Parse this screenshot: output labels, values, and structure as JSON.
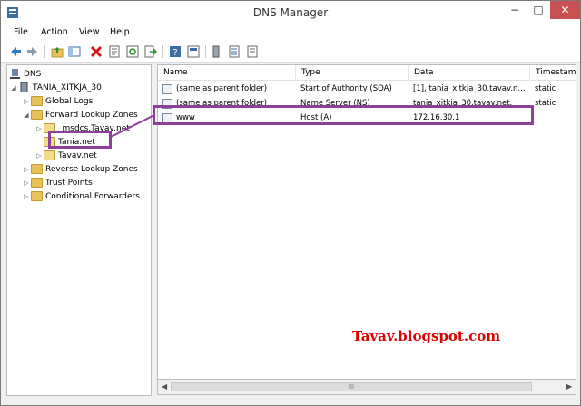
{
  "window": {
    "title": "DNS Manager",
    "minimize": "−",
    "maximize": "□",
    "close": "✕"
  },
  "menu": [
    "File",
    "Action",
    "View",
    "Help"
  ],
  "toolbar": {
    "icons": [
      "back-icon",
      "forward-icon",
      "folder-up-icon",
      "show-hide-tree-icon",
      "delete-icon",
      "properties-icon",
      "refresh-icon",
      "export-icon",
      "help-icon",
      "properties-sheet-icon",
      "server-icon",
      "list-icon",
      "zone-icon"
    ]
  },
  "tree": {
    "root": "DNS",
    "server": "TANIA_XITKJA_30",
    "global_logs": "Global Logs",
    "forward_zones": "Forward Lookup Zones",
    "msdcs": "_msdcs.Tavav.net",
    "tania_net": "Tania.net",
    "tavav_net": "Tavav.net",
    "reverse_zones": "Reverse Lookup Zones",
    "trust_points": "Trust Points",
    "conditional_forwarders": "Conditional Forwarders"
  },
  "table": {
    "columns": [
      "Name",
      "Type",
      "Data",
      "Timestamp"
    ],
    "rows": [
      {
        "name": "(same as parent folder)",
        "type": "Start of Authority (SOA)",
        "data": "[1], tania_xitkja_30.tavav.n...",
        "timestamp": "static"
      },
      {
        "name": "(same as parent folder)",
        "type": "Name Server (NS)",
        "data": "tania_xitkja_30.tavav.net.",
        "timestamp": "static"
      },
      {
        "name": "www",
        "type": "Host (A)",
        "data": "172.16.30.1",
        "timestamp": ""
      }
    ]
  },
  "scrollbar": {
    "left": "◀",
    "right": "▶",
    "grip": "III"
  },
  "watermark": "Tavav.blogspot.com",
  "colors": {
    "highlight": "#8e3f9a",
    "watermark": "#e00000",
    "close_button": "#c75050"
  }
}
